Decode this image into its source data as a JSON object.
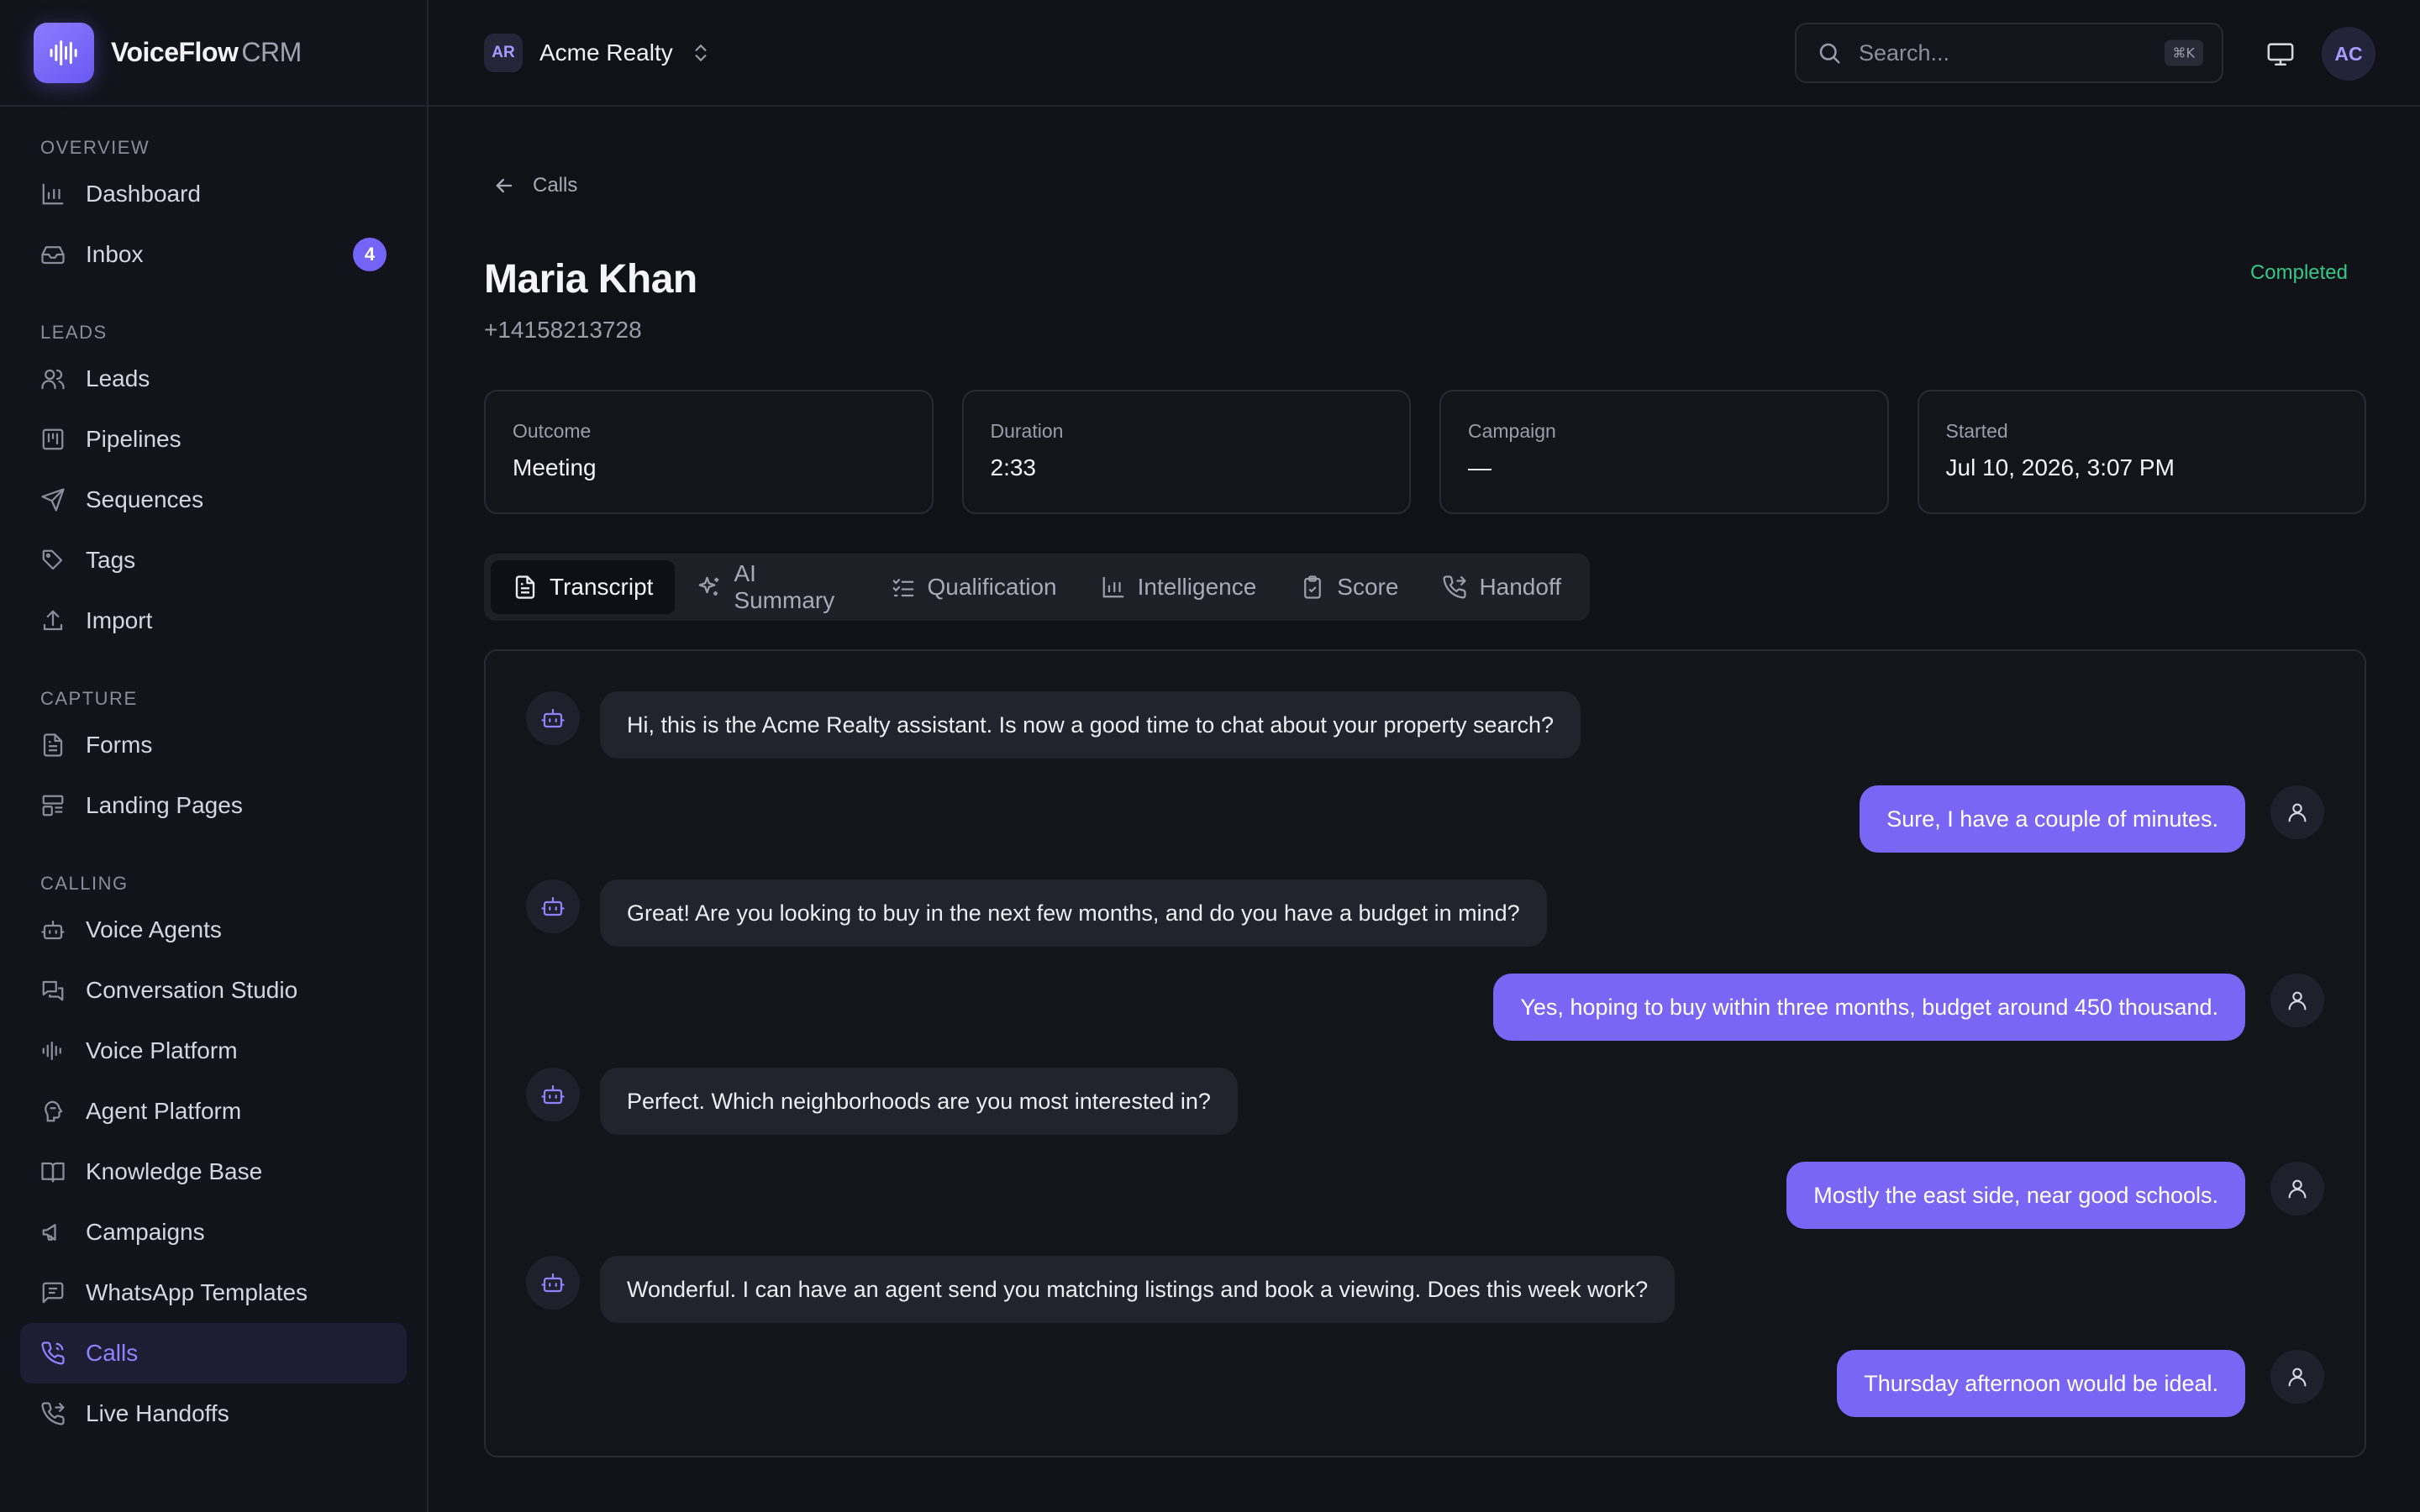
{
  "brand": {
    "name": "VoiceFlow",
    "suffix": "CRM"
  },
  "sidebar": {
    "sections": [
      {
        "title": "Overview",
        "items": [
          {
            "label": "Dashboard",
            "icon": "bar-chart-icon"
          },
          {
            "label": "Inbox",
            "icon": "inbox-icon",
            "badge": "4"
          }
        ]
      },
      {
        "title": "Leads",
        "items": [
          {
            "label": "Leads",
            "icon": "users-icon"
          },
          {
            "label": "Pipelines",
            "icon": "kanban-icon"
          },
          {
            "label": "Sequences",
            "icon": "send-icon"
          },
          {
            "label": "Tags",
            "icon": "tag-icon"
          },
          {
            "label": "Import",
            "icon": "upload-icon"
          }
        ]
      },
      {
        "title": "Capture",
        "items": [
          {
            "label": "Forms",
            "icon": "file-text-icon"
          },
          {
            "label": "Landing Pages",
            "icon": "layout-icon"
          }
        ]
      },
      {
        "title": "Calling",
        "items": [
          {
            "label": "Voice Agents",
            "icon": "bot-icon"
          },
          {
            "label": "Conversation Studio",
            "icon": "chat-icon"
          },
          {
            "label": "Voice Platform",
            "icon": "waveform-icon"
          },
          {
            "label": "Agent Platform",
            "icon": "agent-icon"
          },
          {
            "label": "Knowledge Base",
            "icon": "book-icon"
          },
          {
            "label": "Campaigns",
            "icon": "megaphone-icon"
          },
          {
            "label": "WhatsApp Templates",
            "icon": "message-square-icon"
          },
          {
            "label": "Calls",
            "icon": "phone-icon",
            "active": true
          },
          {
            "label": "Live Handoffs",
            "icon": "phone-forward-icon"
          }
        ]
      }
    ]
  },
  "topbar": {
    "org_initials": "AR",
    "org_name": "Acme Realty",
    "search_placeholder": "Search...",
    "search_shortcut": "⌘K",
    "user_initials": "AC"
  },
  "call": {
    "back_label": "Calls",
    "name": "Maria Khan",
    "phone": "+14158213728",
    "status": "Completed",
    "stats": [
      {
        "label": "Outcome",
        "value": "Meeting"
      },
      {
        "label": "Duration",
        "value": "2:33"
      },
      {
        "label": "Campaign",
        "value": "—"
      },
      {
        "label": "Started",
        "value": "Jul 10, 2026, 3:07 PM"
      }
    ],
    "tabs": [
      {
        "label": "Transcript",
        "icon": "document-icon",
        "active": true
      },
      {
        "label": "AI Summary",
        "icon": "sparkles-icon"
      },
      {
        "label": "Qualification",
        "icon": "checklist-icon"
      },
      {
        "label": "Intelligence",
        "icon": "bar-chart-icon"
      },
      {
        "label": "Score",
        "icon": "clipboard-check-icon"
      },
      {
        "label": "Handoff",
        "icon": "phone-forward-icon"
      }
    ],
    "transcript": [
      {
        "role": "bot",
        "text": "Hi, this is the Acme Realty assistant. Is now a good time to chat about your property search?"
      },
      {
        "role": "user",
        "text": "Sure, I have a couple of minutes."
      },
      {
        "role": "bot",
        "text": "Great! Are you looking to buy in the next few months, and do you have a budget in mind?"
      },
      {
        "role": "user",
        "text": "Yes, hoping to buy within three months, budget around 450 thousand."
      },
      {
        "role": "bot",
        "text": "Perfect. Which neighborhoods are you most interested in?"
      },
      {
        "role": "user",
        "text": "Mostly the east side, near good schools."
      },
      {
        "role": "bot",
        "text": "Wonderful. I can have an agent send you matching listings and book a viewing. Does this week work?"
      },
      {
        "role": "user",
        "text": "Thursday afternoon would be ideal."
      }
    ]
  },
  "colors": {
    "accent": "#7a66f4",
    "success": "#34c88a",
    "background": "#111118"
  }
}
